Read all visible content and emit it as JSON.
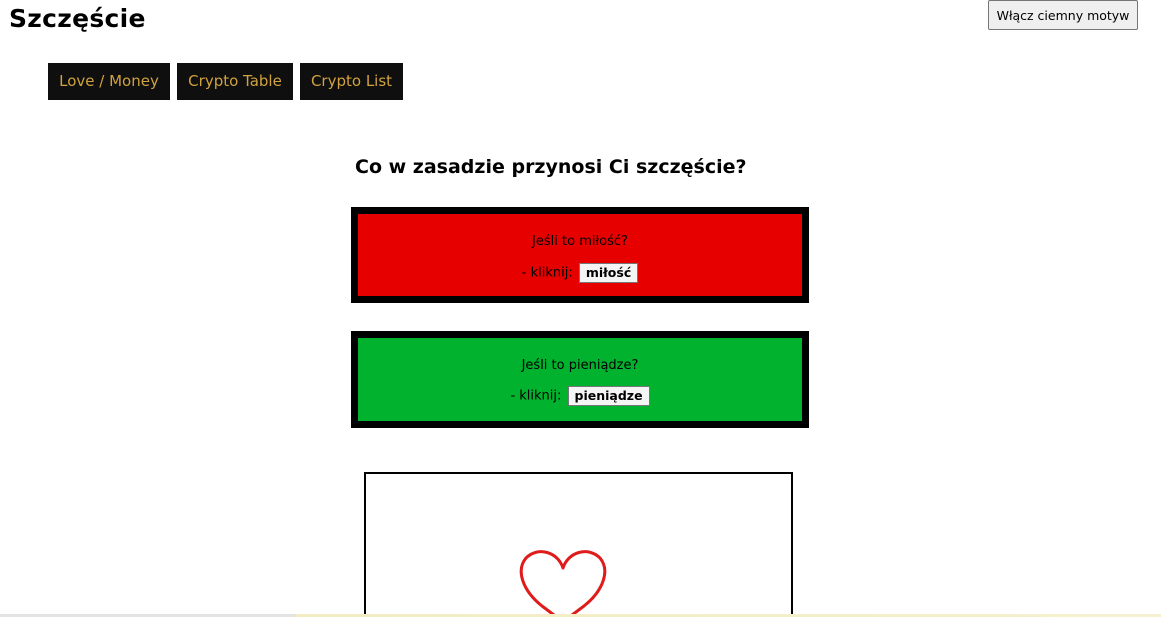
{
  "header": {
    "title": "Szczęście",
    "theme_button": "Włącz ciemny motyw"
  },
  "nav": {
    "items": [
      {
        "label": "Love / Money"
      },
      {
        "label": "Crypto Table"
      },
      {
        "label": "Crypto List"
      }
    ]
  },
  "main": {
    "question": "Co w zasadzie przynosi Ci szczęście?",
    "love": {
      "prompt": "Jeśli to miłość?",
      "click_text": "- kliknij:",
      "button": "miłość",
      "color": "#e60000"
    },
    "money": {
      "prompt": "Jeśli to pieniądze?",
      "click_text": "- kliknij:",
      "button": "pieniądze",
      "color": "#00b22d"
    },
    "result": {
      "icon": "heart-icon",
      "icon_color": "#e01b1b"
    }
  },
  "colors": {
    "nav_background": "#0f0f0f",
    "nav_text": "#d1a23d"
  }
}
